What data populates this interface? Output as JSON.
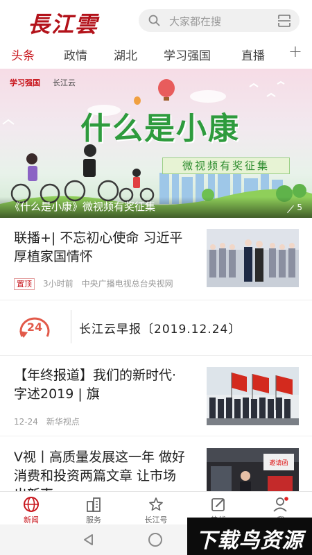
{
  "header": {
    "logo": "長江雲",
    "search_placeholder": "大家都在搜"
  },
  "tabs": [
    {
      "label": "头条",
      "active": true
    },
    {
      "label": "政情",
      "active": false
    },
    {
      "label": "湖北",
      "active": false
    },
    {
      "label": "学习强国",
      "active": false
    },
    {
      "label": "直播",
      "active": false
    }
  ],
  "tab_add": "+",
  "banner": {
    "logo_left": "学习强国",
    "logo_right": "长江云",
    "headline_art": "什么是小康",
    "subline_art": "微视频有奖征集",
    "caption": "《什么是小康》微视频有奖征集",
    "count": "5"
  },
  "news": [
    {
      "title": "联播+| 不忘初心使命 习近平厚植家国情怀",
      "badge": "置顶",
      "time": "3小时前",
      "source": "中央广播电视总台央视网"
    },
    {
      "title": "【年终报道】我们的新时代·字述2019 | 旗",
      "time": "12-24",
      "source": "新华视点"
    },
    {
      "title": "V视丨高质量发展这一年 做好消费和投资两篇文章 让市场出新声"
    }
  ],
  "report": {
    "icon_number": "24",
    "text": "长江云早报〔2019.12.24〕"
  },
  "thumb3_label": "邀请函",
  "bottom_nav": [
    {
      "label": "新闻",
      "icon": "globe-icon",
      "active": true
    },
    {
      "label": "服务",
      "icon": "buildings-icon",
      "active": false
    },
    {
      "label": "长江号",
      "icon": "star-icon",
      "active": false
    },
    {
      "label": "热线",
      "icon": "edit-icon",
      "active": false
    },
    {
      "label": "我",
      "icon": "user-icon",
      "active": false
    }
  ],
  "watermark": "下载鸟资源",
  "colors": {
    "brand": "#c8161d",
    "banner_green": "#2e9b3d"
  }
}
